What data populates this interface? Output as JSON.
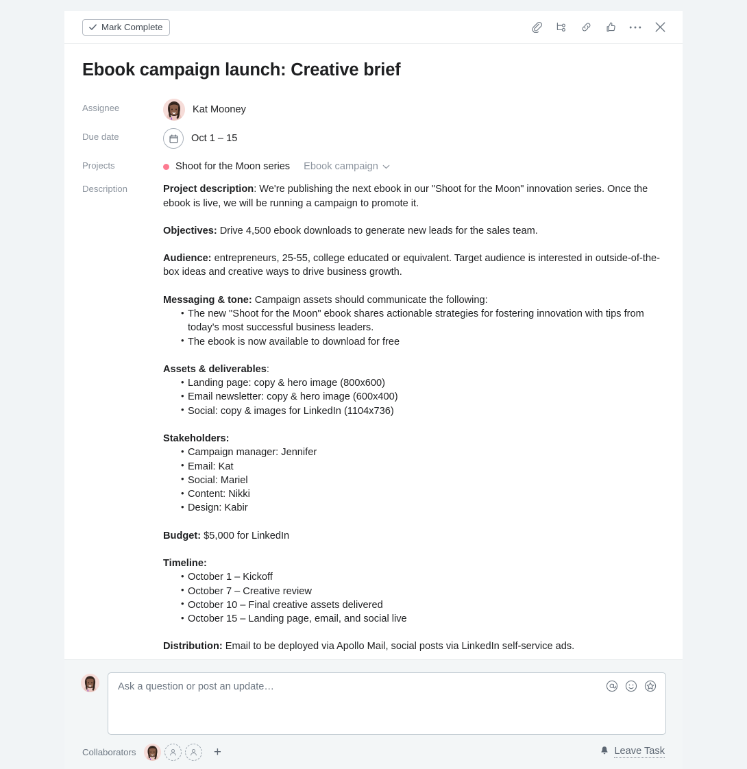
{
  "theme": {
    "page_background": "#f1f4f6",
    "card_background": "#ffffff",
    "footer_background": "#f3f6f7",
    "text_primary": "#1e1f21",
    "text_muted": "#8c949e",
    "project_dot_color": "#fd7a90",
    "border_color": "#bfc9d0"
  },
  "header": {
    "mark_complete_label": "Mark Complete",
    "actions": [
      {
        "name": "attach-icon",
        "label": "Attach"
      },
      {
        "name": "subtask-icon",
        "label": "Add subtask"
      },
      {
        "name": "link-icon",
        "label": "Copy task link"
      },
      {
        "name": "thumbs-up-icon",
        "label": "Like"
      },
      {
        "name": "more-icon",
        "label": "More actions"
      },
      {
        "name": "close-icon",
        "label": "Close"
      }
    ]
  },
  "task": {
    "title": "Ebook campaign launch: Creative brief",
    "fields": {
      "assignee_label": "Assignee",
      "assignee_name": "Kat Mooney",
      "due_date_label": "Due date",
      "due_date_value": "Oct 1 – 15",
      "projects_label": "Projects",
      "project_name": "Shoot for the Moon series",
      "project_section": "Ebook campaign",
      "description_label": "Description"
    }
  },
  "description": {
    "project_description": {
      "heading": "Project description",
      "heading_suffix": ":",
      "text": " We're publishing the next ebook in our \"Shoot for the Moon\" innovation series. Once the ebook is live, we will be running a campaign to promote it."
    },
    "objectives": {
      "heading": "Objectives:",
      "text": " Drive 4,500 ebook downloads to generate new leads for the sales team."
    },
    "audience": {
      "heading": "Audience:",
      "text": " entrepreneurs, 25-55, college educated or equivalent. Target audience is interested in outside-of-the-box ideas and creative ways to drive business growth."
    },
    "messaging": {
      "heading": "Messaging & tone:",
      "text": " Campaign assets should communicate the following:",
      "items": [
        "The new \"Shoot for the Moon\" ebook shares actionable strategies for fostering innovation with tips from today's most successful business leaders.",
        "The ebook is now available to download for free"
      ]
    },
    "assets": {
      "heading": "Assets & deliverables",
      "heading_suffix": ":",
      "items": [
        "Landing page: copy & hero image (800x600)",
        "Email newsletter: copy & hero image (600x400)",
        "Social: copy & images for LinkedIn (1104x736)"
      ]
    },
    "stakeholders": {
      "heading": "Stakeholders:",
      "items": [
        "Campaign manager: Jennifer",
        "Email: Kat",
        "Social: Mariel",
        "Content: Nikki",
        "Design: Kabir"
      ]
    },
    "budget": {
      "heading": "Budget:",
      "text": " $5,000 for LinkedIn"
    },
    "timeline": {
      "heading": "Timeline:",
      "items": [
        "October 1 – Kickoff",
        "October 7 – Creative review",
        "October 10 – Final creative assets delivered",
        "October 15 – Landing page, email, and social live"
      ]
    },
    "distribution": {
      "heading": "Distribution:",
      "text": " Email to be deployed via Apollo Mail, social posts via LinkedIn self-service ads."
    }
  },
  "composer": {
    "placeholder": "Ask a question or post an update…",
    "value": "",
    "tools": [
      {
        "name": "mention-icon",
        "label": "Mention"
      },
      {
        "name": "emoji-icon",
        "label": "Emoji"
      },
      {
        "name": "sticker-icon",
        "label": "Sticker"
      }
    ]
  },
  "collaborators": {
    "label": "Collaborators",
    "add_label": "+",
    "empty_slots": 2,
    "leave_task_label": "Leave Task"
  }
}
